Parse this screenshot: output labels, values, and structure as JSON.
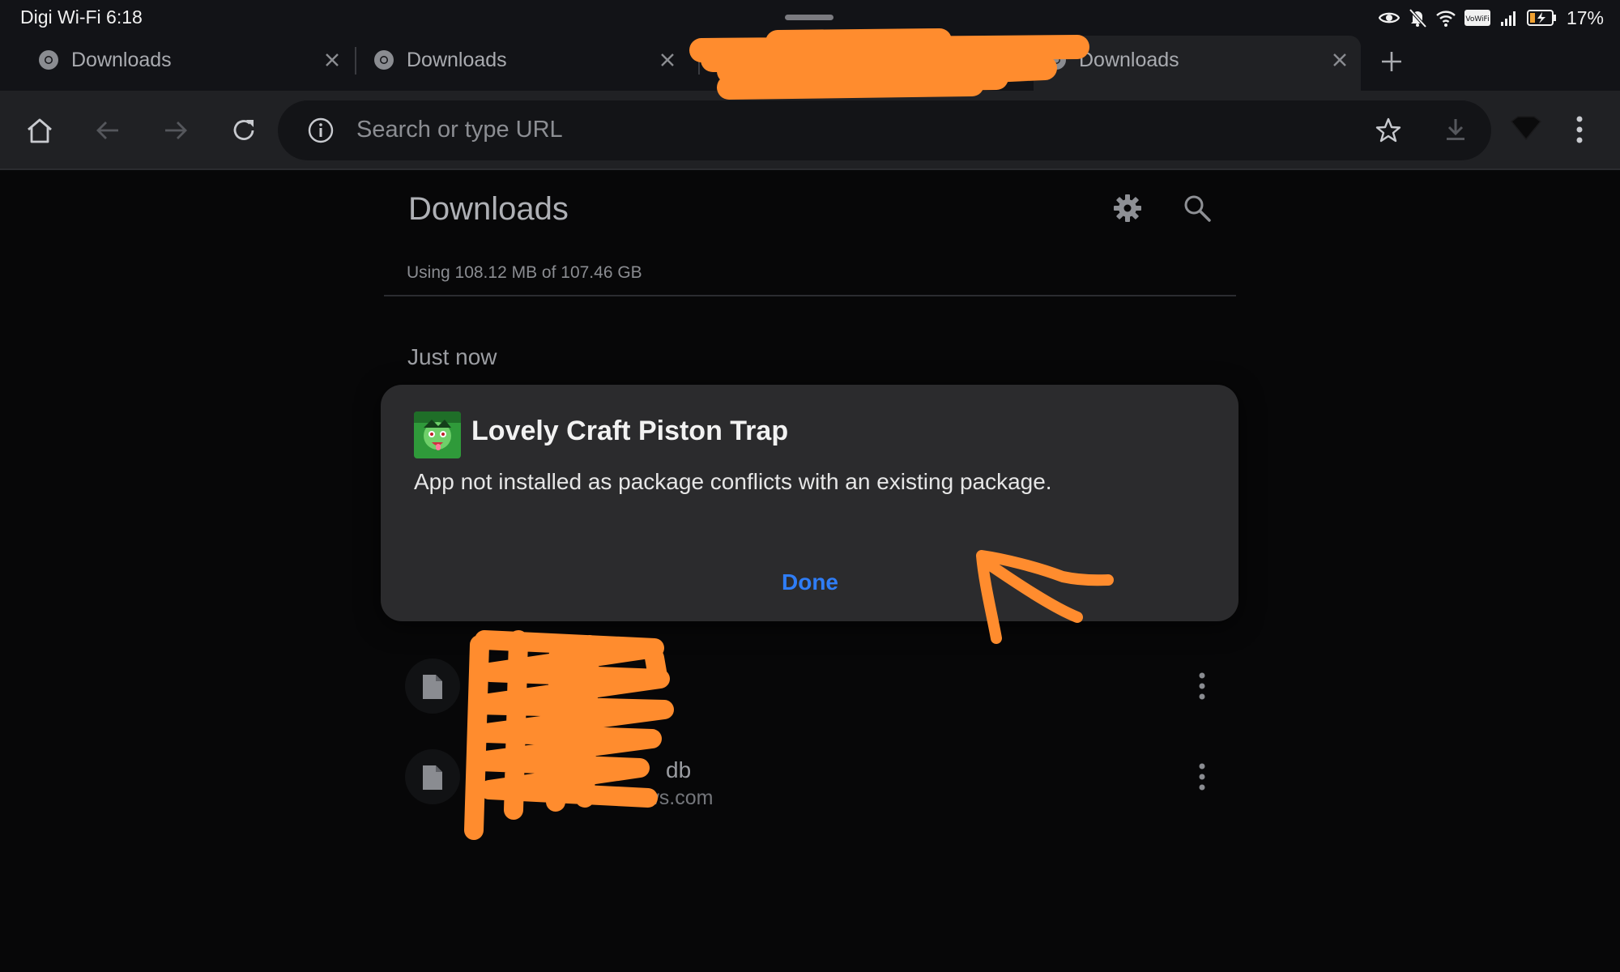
{
  "status_bar": {
    "carrier_time": "Digi Wi-Fi 6:18",
    "battery": "17%",
    "icons": [
      "eye-icon",
      "bell-muted-icon",
      "wifi-icon",
      "vowifi-icon",
      "signal-icon",
      "battery-icon"
    ],
    "vowifi_label": "VoWiFi"
  },
  "tabs": [
    {
      "title": "Downloads",
      "active": false
    },
    {
      "title": "Downloads",
      "active": false
    },
    {
      "title": "",
      "active": false
    },
    {
      "title": "Downloads",
      "active": true
    }
  ],
  "toolbar": {
    "omnibox_placeholder": "Search or type URL"
  },
  "page": {
    "title": "Downloads",
    "storage": "Using 108.12 MB of 107.46 GB",
    "section": "Just now",
    "items": [
      {
        "name": "",
        "sub": ""
      },
      {
        "name": "db",
        "sub": "onaws.com"
      }
    ]
  },
  "dialog": {
    "title": "Lovely Craft Piston Trap",
    "message": "App not installed as package conflicts with an existing package.",
    "done_label": "Done"
  },
  "colors": {
    "accent": "#2f7df6",
    "annotation": "#ff8c2e",
    "background": "#070708",
    "dialog": "#2b2b2d"
  }
}
